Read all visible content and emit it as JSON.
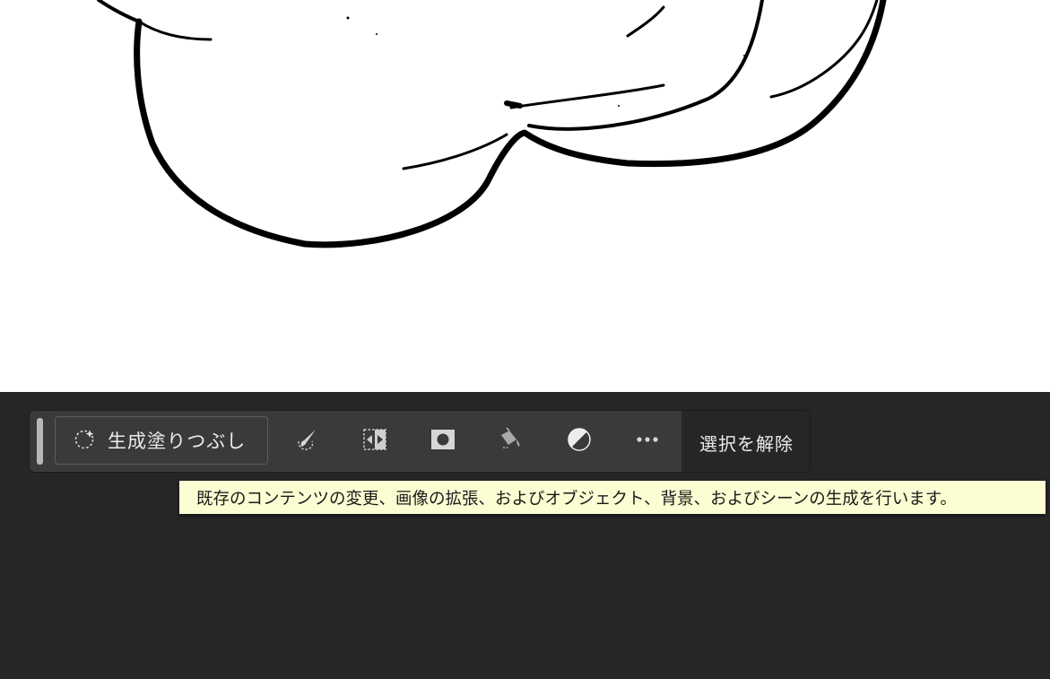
{
  "contextual_taskbar": {
    "generative_fill": {
      "label": "生成塗りつぶし",
      "icon": "sparkle-selection-icon"
    },
    "tools": [
      {
        "name": "brush-select-icon"
      },
      {
        "name": "transform-selection-icon"
      },
      {
        "name": "layer-mask-icon"
      },
      {
        "name": "fill-bucket-icon"
      },
      {
        "name": "adjustment-layer-icon"
      },
      {
        "name": "more-options-icon"
      }
    ],
    "deselect_label": "選択を解除"
  },
  "tooltip": {
    "text": "既存のコンテンツの変更、画像の拡張、およびオブジェクト、背景、およびシーンの生成を行います。"
  },
  "colors": {
    "taskbar_bg": "#3a3a3a",
    "workspace_bg": "#262626",
    "tooltip_bg": "#fdfdd3",
    "canvas_bg": "#ffffff"
  }
}
